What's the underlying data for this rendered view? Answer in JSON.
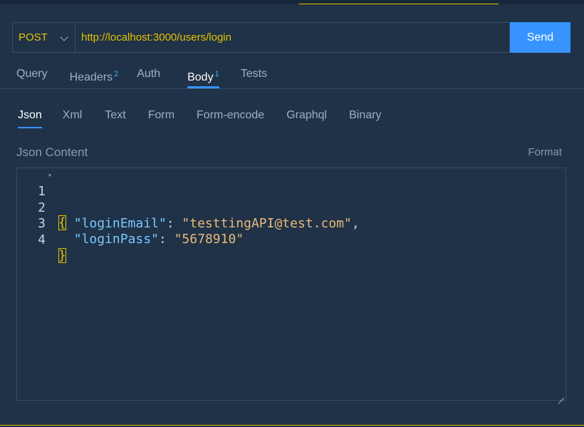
{
  "request": {
    "method": "POST",
    "url": "http://localhost:3000/users/login",
    "send_label": "Send"
  },
  "tabs": [
    {
      "label": "Query",
      "badge": ""
    },
    {
      "label": "Headers",
      "badge": "2"
    },
    {
      "label": "Auth",
      "badge": ""
    },
    {
      "label": "Body",
      "badge": "1",
      "active": true
    },
    {
      "label": "Tests",
      "badge": ""
    }
  ],
  "body_types": [
    {
      "label": "Json",
      "active": true
    },
    {
      "label": "Xml"
    },
    {
      "label": "Text"
    },
    {
      "label": "Form"
    },
    {
      "label": "Form-encode"
    },
    {
      "label": "Graphql"
    },
    {
      "label": "Binary"
    }
  ],
  "content": {
    "label": "Json Content",
    "format_label": "Format"
  },
  "editor": {
    "lines": [
      {
        "number": "1",
        "open_brace": "{"
      },
      {
        "number": "2",
        "key": "\"loginEmail\"",
        "value": "\"testtingAPI@test.com\"",
        "trailing": ","
      },
      {
        "number": "3",
        "key": "\"loginPass\"",
        "value": "\"5678910\"",
        "trailing": ""
      },
      {
        "number": "4",
        "close_brace": "}"
      }
    ]
  },
  "colors": {
    "background": "#1f3247",
    "accent": "#3794ff",
    "method_text": "#e6c200",
    "json_key": "#7cc7ff",
    "json_string": "#e8b87a"
  }
}
